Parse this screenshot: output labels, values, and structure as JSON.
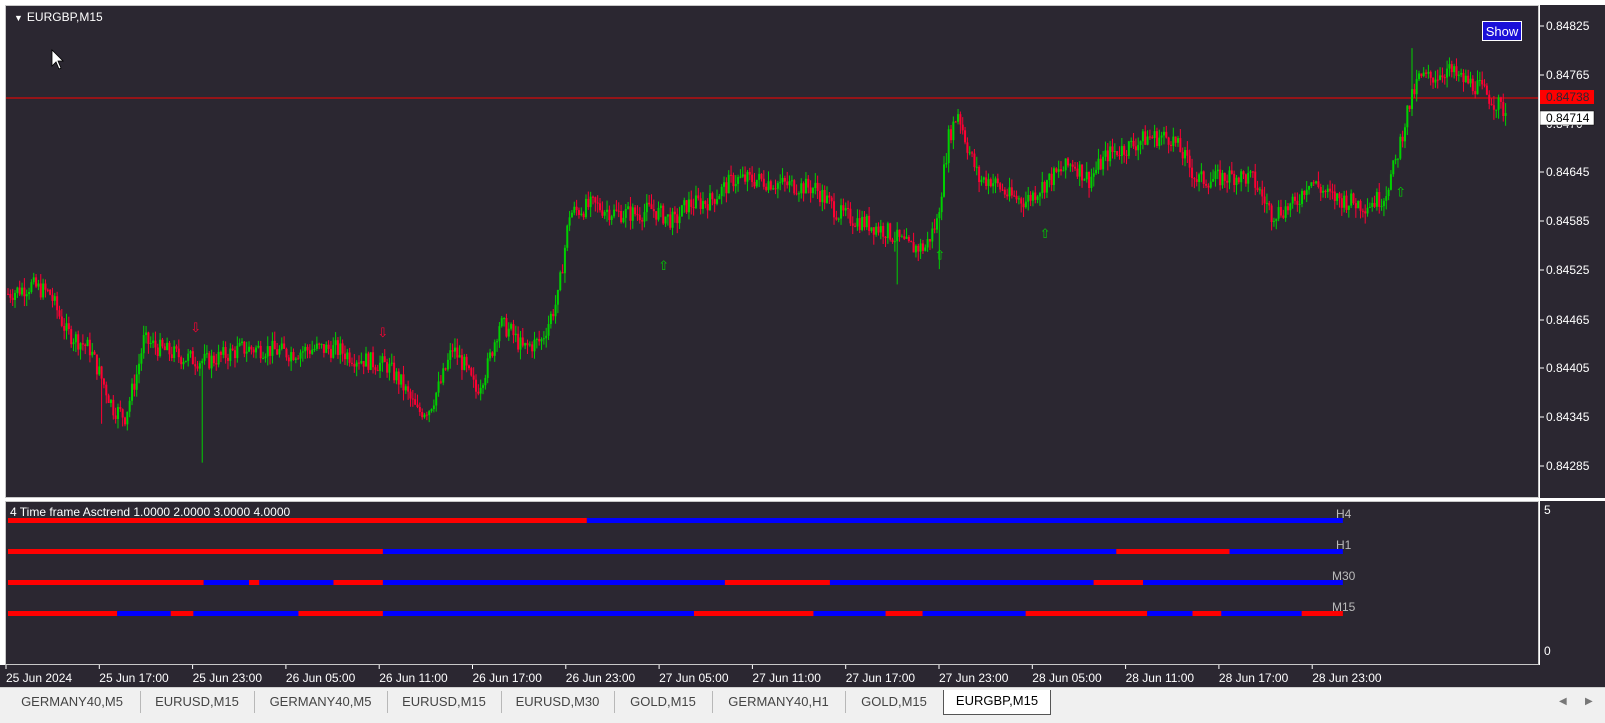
{
  "chart": {
    "title": "EURGBP,M15",
    "show_button": "Show",
    "price_labels": [
      "0.84825",
      "0.84765",
      "0.84645",
      "0.84585",
      "0.84525",
      "0.84465",
      "0.84405",
      "0.84345",
      "0.84285"
    ],
    "price_partial": "0.8470",
    "bid_label": "0.84738",
    "ask_label": "0.84714",
    "colors": {
      "bull": "#00d000",
      "bear": "#ff0033",
      "background": "#2b2731",
      "bid_line": "#ff0000"
    },
    "signals": [
      {
        "type": "down-arrow",
        "bar": 80
      },
      {
        "type": "down-arrow",
        "bar": 160
      },
      {
        "type": "up-arrow",
        "bar": 280
      },
      {
        "type": "up-arrow",
        "bar": 398
      },
      {
        "type": "up-arrow",
        "bar": 443
      },
      {
        "type": "up-arrow",
        "bar": 595
      }
    ]
  },
  "indicator": {
    "title": "4 Time frame Asctrend 1.0000 2.0000 3.0000 4.0000",
    "scale_top": "5",
    "scale_bottom": "0",
    "colors": {
      "up": "#0000ff",
      "down": "#ff0000"
    },
    "rows": [
      {
        "label": "H4",
        "segments": [
          [
            "down",
            0,
            281
          ],
          [
            "up",
            281,
            648
          ]
        ]
      },
      {
        "label": "H1",
        "segments": [
          [
            "down",
            0,
            182
          ],
          [
            "up",
            182,
            538
          ],
          [
            "down",
            538,
            593
          ],
          [
            "up",
            593,
            648
          ]
        ]
      },
      {
        "label": "M30",
        "segments": [
          [
            "down",
            0,
            95
          ],
          [
            "up",
            95,
            117
          ],
          [
            "down",
            117,
            122
          ],
          [
            "up",
            122,
            158
          ],
          [
            "down",
            158,
            182
          ],
          [
            "up",
            182,
            348
          ],
          [
            "down",
            348,
            399
          ],
          [
            "up",
            399,
            527
          ],
          [
            "down",
            527,
            551
          ],
          [
            "up",
            551,
            648
          ]
        ]
      },
      {
        "label": "M15",
        "segments": [
          [
            "down",
            0,
            53
          ],
          [
            "up",
            53,
            79
          ],
          [
            "down",
            79,
            90
          ],
          [
            "up",
            90,
            141
          ],
          [
            "down",
            141,
            182
          ],
          [
            "up",
            182,
            333
          ],
          [
            "down",
            333,
            391
          ],
          [
            "up",
            391,
            426
          ],
          [
            "down",
            426,
            444
          ],
          [
            "up",
            444,
            494
          ],
          [
            "down",
            494,
            553
          ],
          [
            "up",
            553,
            575
          ],
          [
            "down",
            575,
            589
          ],
          [
            "up",
            589,
            628
          ],
          [
            "down",
            628,
            648
          ]
        ]
      }
    ]
  },
  "time_axis": [
    "25 Jun 2024",
    "25 Jun 17:00",
    "25 Jun 23:00",
    "26 Jun 05:00",
    "26 Jun 11:00",
    "26 Jun 17:00",
    "26 Jun 23:00",
    "27 Jun 05:00",
    "27 Jun 11:00",
    "27 Jun 17:00",
    "27 Jun 23:00",
    "28 Jun 05:00",
    "28 Jun 11:00",
    "28 Jun 17:00",
    "28 Jun 23:00"
  ],
  "tabs": [
    {
      "label": "GERMANY40,M5",
      "active": false
    },
    {
      "label": "EURUSD,M15",
      "active": false
    },
    {
      "label": "GERMANY40,M5",
      "active": false
    },
    {
      "label": "EURUSD,M15",
      "active": false
    },
    {
      "label": "EURUSD,M30",
      "active": false
    },
    {
      "label": "GOLD,M15",
      "active": false
    },
    {
      "label": "GERMANY40,H1",
      "active": false
    },
    {
      "label": "GOLD,M15",
      "active": false
    },
    {
      "label": "EURGBP,M15",
      "active": true
    }
  ],
  "chart_data": {
    "type": "line",
    "price_anchors": [
      [
        0,
        0.84505
      ],
      [
        10,
        0.84515
      ],
      [
        18,
        0.84505
      ],
      [
        25,
        0.8446
      ],
      [
        35,
        0.8444
      ],
      [
        45,
        0.8437
      ],
      [
        50,
        0.8436
      ],
      [
        55,
        0.8441
      ],
      [
        58,
        0.8445
      ],
      [
        65,
        0.8444
      ],
      [
        75,
        0.8443
      ],
      [
        85,
        0.84425
      ],
      [
        95,
        0.84435
      ],
      [
        100,
        0.8444
      ],
      [
        110,
        0.8444
      ],
      [
        120,
        0.84435
      ],
      [
        130,
        0.8444
      ],
      [
        140,
        0.8444
      ],
      [
        148,
        0.8443
      ],
      [
        155,
        0.84425
      ],
      [
        162,
        0.8442
      ],
      [
        168,
        0.844
      ],
      [
        175,
        0.84365
      ],
      [
        180,
        0.8437
      ],
      [
        185,
        0.844
      ],
      [
        190,
        0.8444
      ],
      [
        195,
        0.8442
      ],
      [
        200,
        0.8439
      ],
      [
        205,
        0.8442
      ],
      [
        210,
        0.8447
      ],
      [
        215,
        0.8446
      ],
      [
        220,
        0.8444
      ],
      [
        228,
        0.8445
      ],
      [
        235,
        0.845
      ],
      [
        240,
        0.846
      ],
      [
        250,
        0.8461
      ],
      [
        260,
        0.846
      ],
      [
        270,
        0.846
      ],
      [
        275,
        0.84605
      ],
      [
        285,
        0.8459
      ],
      [
        290,
        0.8461
      ],
      [
        300,
        0.84615
      ],
      [
        310,
        0.8464
      ],
      [
        320,
        0.8464
      ],
      [
        330,
        0.84635
      ],
      [
        345,
        0.8463
      ],
      [
        355,
        0.846
      ],
      [
        365,
        0.8459
      ],
      [
        375,
        0.8458
      ],
      [
        385,
        0.8456
      ],
      [
        392,
        0.8456
      ],
      [
        397,
        0.8459
      ],
      [
        402,
        0.8469
      ],
      [
        406,
        0.8472
      ],
      [
        410,
        0.8468
      ],
      [
        415,
        0.8464
      ],
      [
        420,
        0.8464
      ],
      [
        428,
        0.8462
      ],
      [
        435,
        0.84615
      ],
      [
        445,
        0.8464
      ],
      [
        455,
        0.8466
      ],
      [
        462,
        0.8464
      ],
      [
        470,
        0.8467
      ],
      [
        480,
        0.8468
      ],
      [
        487,
        0.8469
      ],
      [
        492,
        0.8469
      ],
      [
        497,
        0.8469
      ],
      [
        502,
        0.8467
      ],
      [
        508,
        0.8464
      ],
      [
        515,
        0.8464
      ],
      [
        525,
        0.84645
      ],
      [
        532,
        0.8464
      ],
      [
        540,
        0.846
      ],
      [
        550,
        0.8461
      ],
      [
        556,
        0.8464
      ],
      [
        565,
        0.8462
      ],
      [
        572,
        0.84615
      ],
      [
        580,
        0.8461
      ],
      [
        588,
        0.8462
      ],
      [
        593,
        0.8466
      ],
      [
        598,
        0.8472
      ],
      [
        603,
        0.8476
      ],
      [
        608,
        0.8476
      ],
      [
        615,
        0.8477
      ],
      [
        620,
        0.8476
      ],
      [
        628,
        0.8475
      ],
      [
        636,
        0.8473
      ],
      [
        640,
        0.8472
      ]
    ],
    "x": [
      "25 Jun 2024",
      "25 Jun 17:00",
      "25 Jun 23:00",
      "26 Jun 05:00",
      "26 Jun 11:00",
      "26 Jun 17:00",
      "26 Jun 23:00",
      "27 Jun 05:00",
      "27 Jun 11:00",
      "27 Jun 17:00",
      "27 Jun 23:00",
      "28 Jun 05:00",
      "28 Jun 11:00",
      "28 Jun 17:00",
      "28 Jun 23:00"
    ],
    "ylim": [
      0.84265,
      0.84845
    ],
    "grid": false
  }
}
